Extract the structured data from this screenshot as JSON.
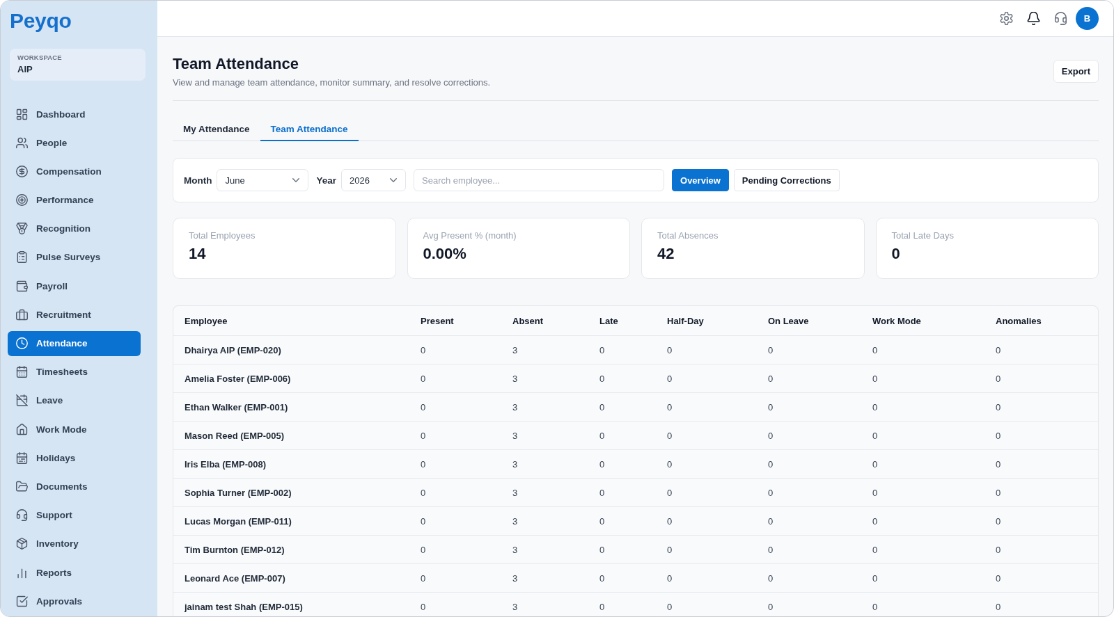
{
  "sidebar": {
    "logo": "Peyqo",
    "workspace": {
      "label": "WORKSPACE",
      "name": "AIP"
    },
    "items": [
      {
        "label": "Dashboard",
        "selected": false
      },
      {
        "label": "People",
        "selected": false
      },
      {
        "label": "Compensation",
        "selected": false
      },
      {
        "label": "Performance",
        "selected": false
      },
      {
        "label": "Recognition",
        "selected": false
      },
      {
        "label": "Pulse Surveys",
        "selected": false
      },
      {
        "label": "Payroll",
        "selected": false
      },
      {
        "label": "Recruitment",
        "selected": false
      },
      {
        "label": "Attendance",
        "selected": true
      },
      {
        "label": "Timesheets",
        "selected": false
      },
      {
        "label": "Leave",
        "selected": false
      },
      {
        "label": "Work Mode",
        "selected": false
      },
      {
        "label": "Holidays",
        "selected": false
      },
      {
        "label": "Documents",
        "selected": false
      },
      {
        "label": "Support",
        "selected": false
      },
      {
        "label": "Inventory",
        "selected": false
      },
      {
        "label": "Reports",
        "selected": false
      },
      {
        "label": "Approvals",
        "selected": false
      }
    ]
  },
  "top_bar": {
    "avatar_initial": "B"
  },
  "page": {
    "title": "Team Attendance",
    "subtitle": "View and manage team attendance, monitor summary, and resolve corrections.",
    "export_button": "Export"
  },
  "tabs": [
    {
      "label": "My Attendance",
      "selected": false
    },
    {
      "label": "Team Attendance",
      "selected": true
    }
  ],
  "filters": {
    "month": {
      "label": "Month",
      "value": "June"
    },
    "year": {
      "label": "Year",
      "value": "2026"
    },
    "search": {
      "placeholder": "Search employee..."
    },
    "views": [
      {
        "label": "Overview",
        "selected": true
      },
      {
        "label": "Pending Corrections",
        "selected": false
      }
    ]
  },
  "stats": [
    {
      "label": "Total Employees",
      "value": "14"
    },
    {
      "label": "Avg Present % (month)",
      "value": "0.00%"
    },
    {
      "label": "Total Absences",
      "value": "42"
    },
    {
      "label": "Total Late Days",
      "value": "0"
    }
  ],
  "table": {
    "columns": [
      "Employee",
      "Present",
      "Absent",
      "Late",
      "Half-Day",
      "On Leave",
      "Work Mode",
      "Anomalies"
    ],
    "rows": [
      [
        "Dhairya AIP (EMP-020)",
        "0",
        "3",
        "0",
        "0",
        "0",
        "0",
        "0"
      ],
      [
        "Amelia Foster (EMP-006)",
        "0",
        "3",
        "0",
        "0",
        "0",
        "0",
        "0"
      ],
      [
        "Ethan Walker (EMP-001)",
        "0",
        "3",
        "0",
        "0",
        "0",
        "0",
        "0"
      ],
      [
        "Mason Reed (EMP-005)",
        "0",
        "3",
        "0",
        "0",
        "0",
        "0",
        "0"
      ],
      [
        "Iris Elba (EMP-008)",
        "0",
        "3",
        "0",
        "0",
        "0",
        "0",
        "0"
      ],
      [
        "Sophia Turner (EMP-002)",
        "0",
        "3",
        "0",
        "0",
        "0",
        "0",
        "0"
      ],
      [
        "Lucas Morgan (EMP-011)",
        "0",
        "3",
        "0",
        "0",
        "0",
        "0",
        "0"
      ],
      [
        "Tim Burnton (EMP-012)",
        "0",
        "3",
        "0",
        "0",
        "0",
        "0",
        "0"
      ],
      [
        "Leonard Ace (EMP-007)",
        "0",
        "3",
        "0",
        "0",
        "0",
        "0",
        "0"
      ],
      [
        "jainam test Shah (EMP-015)",
        "0",
        "3",
        "0",
        "0",
        "0",
        "0",
        "0"
      ]
    ]
  }
}
